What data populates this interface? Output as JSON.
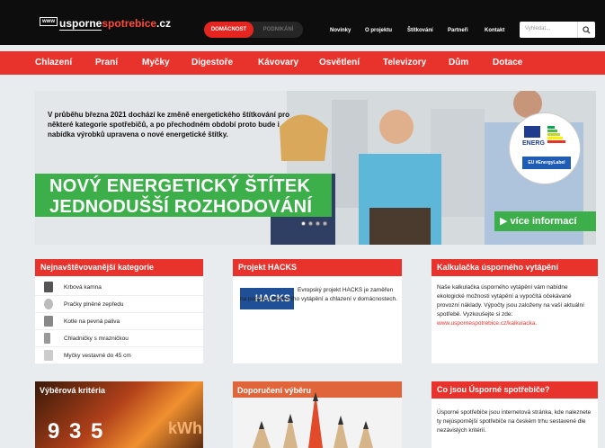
{
  "header": {
    "logo": {
      "badge": "www",
      "part1": "usporne",
      "part2": "spotrebice",
      "part3": ".cz"
    },
    "segment": {
      "active": "DOMÁCNOST",
      "inactive": "PODNIKÁNÍ"
    },
    "nav": [
      "Novinky",
      "O projektu",
      "Štítkování",
      "Partneři",
      "Kontakt"
    ],
    "search": {
      "placeholder": "Vyhledat..."
    }
  },
  "categories": [
    "Chlazení",
    "Praní",
    "Myčky",
    "Digestoře",
    "Kávovary",
    "Osvětlení",
    "Televizory",
    "Dům",
    "Dotace"
  ],
  "hero": {
    "text": "V průběhu března 2021 dochází ke změně energetického štítkování pro některé kategorie spotřebičů, a po přechodném období proto bude i nabídka výrobků upravena o nové energetické štítky.",
    "headline1": "NOVÝ ENERGETICKÝ ŠTÍTEK",
    "headline2": "JEDNODUŠŠÍ ROZHODOVÁNÍ",
    "more": "více informací",
    "energy_label": {
      "word": "ENERG",
      "tag": "EU #EnergyLabel"
    }
  },
  "popular": {
    "title": "Nejnavštěvovanější kategorie",
    "items": [
      "Krbová kamna",
      "Pračky plněné zepředu",
      "Kotle na pevná paliva",
      "Chladničky s mrazničkou",
      "Myčky vestavné do 45 cm"
    ]
  },
  "hacks": {
    "title": "Projekt HACKS",
    "logo": "HACKS",
    "text": "Evropský projekt HACKS je zaměřen na podporu efektivního vytápění a chlazení v domácnostech."
  },
  "calc": {
    "title": "Kalkulačka úsporného vytápění",
    "text": "Naše kalkulačka úsporného vytápění vám nabídne ekologické možnosti vytápění a vypočítá očekávané provozní náklady. Výpočty jsou založeny na vaší aktuální spotřebě. Vyzkoušejte si zde:",
    "link": "www.uspornespotrebice.cz/kalkulacka."
  },
  "criteria": {
    "title": "Výběrová kritéria",
    "digits": "9 3 5",
    "unit": "kWh"
  },
  "recommend": {
    "title": "Doporučení výběru"
  },
  "about": {
    "title": "Co jsou Úsporné spotřebiče?",
    "text": "Úsporné spotřebiče jsou internetová stránka, kde naleznete ty nejúspornější spotřebiče na českém trhu sestavené dle nezávislých kritérií."
  },
  "colors": {
    "accent": "#e8322c",
    "green": "#3cae4a",
    "dark": "#0d0d0d"
  }
}
